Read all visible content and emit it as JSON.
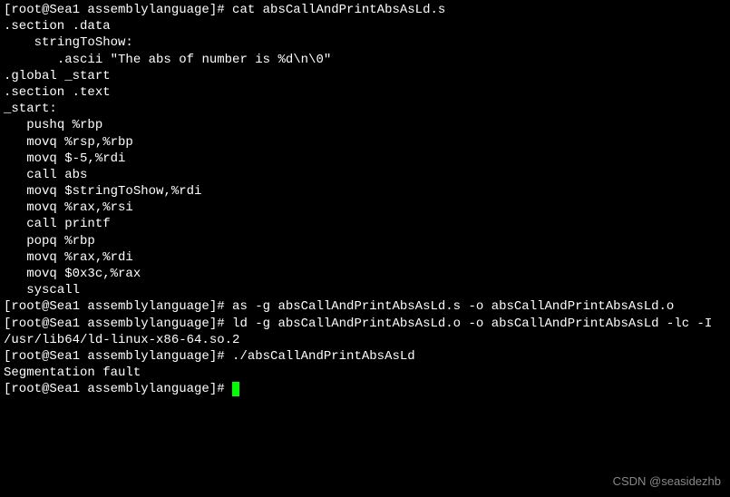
{
  "lines": {
    "l1": "[root@Sea1 assemblylanguage]# cat absCallAndPrintAbsAsLd.s",
    "l2": ".section .data",
    "l3": "    stringToShow:",
    "l4": "       .ascii \"The abs of number is %d\\n\\0\"",
    "l5": ".global _start",
    "l6": ".section .text",
    "l7": "_start:",
    "l8": "   pushq %rbp",
    "l9": "   movq %rsp,%rbp",
    "l10": "   movq $-5,%rdi",
    "l11": "   call abs",
    "l12": "",
    "l13": "   movq $stringToShow,%rdi",
    "l14": "   movq %rax,%rsi",
    "l15": "   call printf",
    "l16": "",
    "l17": "   popq %rbp",
    "l18": "   movq %rax,%rdi",
    "l19": "   movq $0x3c,%rax",
    "l20": "   syscall",
    "l21": "[root@Sea1 assemblylanguage]# as -g absCallAndPrintAbsAsLd.s -o absCallAndPrintAbsAsLd.o",
    "l22": "[root@Sea1 assemblylanguage]# ld -g absCallAndPrintAbsAsLd.o -o absCallAndPrintAbsAsLd -lc -I /usr/lib64/ld-linux-x86-64.so.2",
    "l23": "[root@Sea1 assemblylanguage]# ./absCallAndPrintAbsAsLd",
    "l24": "Segmentation fault",
    "l25": "[root@Sea1 assemblylanguage]# "
  },
  "watermark": "CSDN @seasidezhb"
}
